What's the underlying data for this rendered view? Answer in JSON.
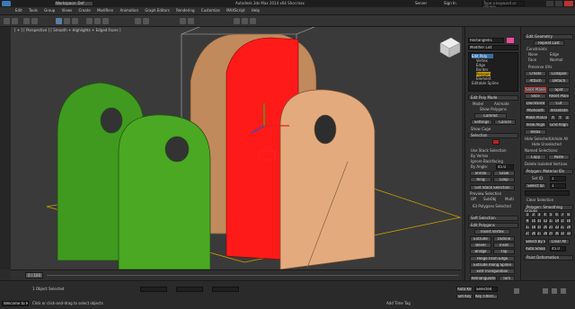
{
  "titlebar": {
    "workspace": "Workspace: Def",
    "title": "Autodesk 3ds Max  2014 x64    Shor.max",
    "search_placeholder": "Type a keyword or phrase",
    "user": "Server",
    "sign_in": "Sign In"
  },
  "menubar": {
    "items": [
      "Edit",
      "Tools",
      "Group",
      "Views",
      "Create",
      "Modifiers",
      "Animation",
      "Graph Editors",
      "Rendering",
      "Customize",
      "MAXScript",
      "Help"
    ]
  },
  "viewport": {
    "label": "[ + ] [ Perspective ] [ Smooth + Highlights + Edged Faces ]"
  },
  "timeline": {
    "frame": "0 / 100"
  },
  "status": {
    "selected": "1 Object Selected",
    "welcome": "Welcome to M",
    "prompt": "Click or click-and-drag to select objects",
    "add_time_tag": "Add Time Tag",
    "auto_key": "Auto Key",
    "selected_mode": "Selected",
    "set_key": "Set Key",
    "key_filters": "Key Filters..."
  },
  "panel_a": {
    "object_name": "Rectangle01",
    "modifier_list": "Modifier List",
    "stack": [
      "Edit Poly",
      "Vertex",
      "Edge",
      "Border",
      "Polygon",
      "Element",
      "Editable Spline"
    ],
    "edit_poly_mode": "Edit Poly Mode",
    "model": "Model",
    "animate": "Animate",
    "show_polygons": "Show Polygons",
    "commit": "Commit",
    "settings": "Settings",
    "cancel": "Cancel",
    "show_cage": "Show Cage",
    "selection": "Selection",
    "use_stack_selection": "Use Stack Selection",
    "by_vertex": "By Vertex",
    "ignore_backfacing": "Ignore Backfacing",
    "by_angle": "By Angle:",
    "angle_value": "45.0",
    "shrink": "Shrink",
    "grow": "Grow",
    "ring": "Ring",
    "loop": "Loop",
    "get_stack_selection": "Get Stack Selection",
    "preview_selection": "Preview Selection",
    "off": "Off",
    "subobj": "SubObj",
    "multi": "Multi",
    "polygons_selected": "63 Polygons Selected",
    "soft_selection": "Soft Selection",
    "edit_polygons": "Edit Polygons",
    "insert_vertex": "Insert Vertex",
    "extrude": "Extrude",
    "outline": "Outline",
    "bevel": "Bevel",
    "inset": "Inset",
    "bridge": "Bridge",
    "flip": "Flip",
    "hinge_from_edge": "Hinge From Edge",
    "extrude_along_spline": "Extrude Along Spline",
    "edit_triangulation": "Edit Triangulation",
    "retriangulate": "Retriangulate",
    "turn": "Turn"
  },
  "panel_b": {
    "edit_geometry": "Edit Geometry",
    "repeat_last": "Repeat Last",
    "constraints": "Constraints",
    "none": "None",
    "edge": "Edge",
    "face": "Face",
    "normal": "Normal",
    "preserve_uvs": "Preserve UVs",
    "create": "Create",
    "collapse": "Collapse",
    "attach": "Attach",
    "detach": "Detach",
    "slice_plane": "Slice Plane",
    "split": "Split",
    "slice": "Slice",
    "reset_plane": "Reset Plane",
    "quickslice": "QuickSlice",
    "cut": "Cut",
    "msmooth": "MSmooth",
    "tessellate": "Tessellate",
    "make_planar": "Make Planar",
    "x": "X",
    "y": "Y",
    "z": "Z",
    "view_align": "View Align",
    "grid_align": "Grid Align",
    "relax": "Relax",
    "hide_selected": "Hide Selected",
    "unhide_all": "Unhide All",
    "hide_unselected": "Hide Unselected",
    "named_selections": "Named Selections:",
    "copy": "Copy",
    "paste": "Paste",
    "delete_isolated": "Delete Isolated Vertices",
    "polygon_material_ids": "Polygon: Material IDs",
    "set_id": "Set ID:",
    "set_id_value": "1",
    "select_id": "Select ID",
    "select_id_value": "1",
    "clear_selection": "Clear Selection",
    "smoothing_groups": "Polygon: Smoothing Groups",
    "sg": [
      "1",
      "2",
      "3",
      "4",
      "5",
      "6",
      "7",
      "8",
      "9",
      "10",
      "11",
      "12",
      "13",
      "14",
      "15",
      "16",
      "17",
      "18",
      "19",
      "20",
      "21",
      "22",
      "23",
      "24",
      "25",
      "26",
      "27",
      "28",
      "29",
      "30",
      "31",
      "32"
    ],
    "select_by_sg": "Select By SG",
    "clear_all": "Clear All",
    "auto_smooth": "Auto Smooth",
    "auto_smooth_value": "45.0",
    "paint_deformation": "Paint Deformation"
  }
}
